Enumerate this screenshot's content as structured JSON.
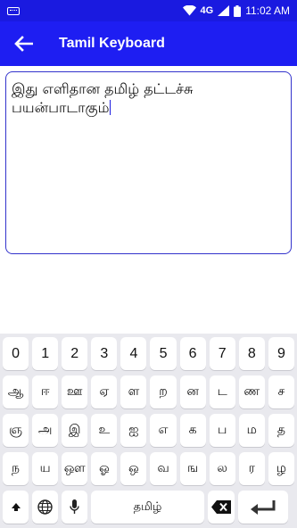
{
  "status": {
    "network": "4G",
    "time": "11:02 AM"
  },
  "appbar": {
    "title": "Tamil Keyboard"
  },
  "editor": {
    "text": "இது எளிதான தமிழ் தட்டச்சு\nபயன்பாடாகும்"
  },
  "keyboard": {
    "row1": [
      "0",
      "1",
      "2",
      "3",
      "4",
      "5",
      "6",
      "7",
      "8",
      "9"
    ],
    "row2": [
      "ஆ",
      "ஈ",
      "ஊ",
      "ஏ",
      "ள",
      "ற",
      "ன",
      "ட",
      "ண",
      "ச"
    ],
    "row3": [
      "ஞ",
      "அ",
      "இ",
      "உ",
      "ஐ",
      "எ",
      "க",
      "ப",
      "ம",
      "த"
    ],
    "row4": [
      "ந",
      "ய",
      "ஔ",
      "ஓ",
      "ஒ",
      "வ",
      "ங",
      "ல",
      "ர",
      "ழ"
    ],
    "space_label": "தமிழ்"
  }
}
